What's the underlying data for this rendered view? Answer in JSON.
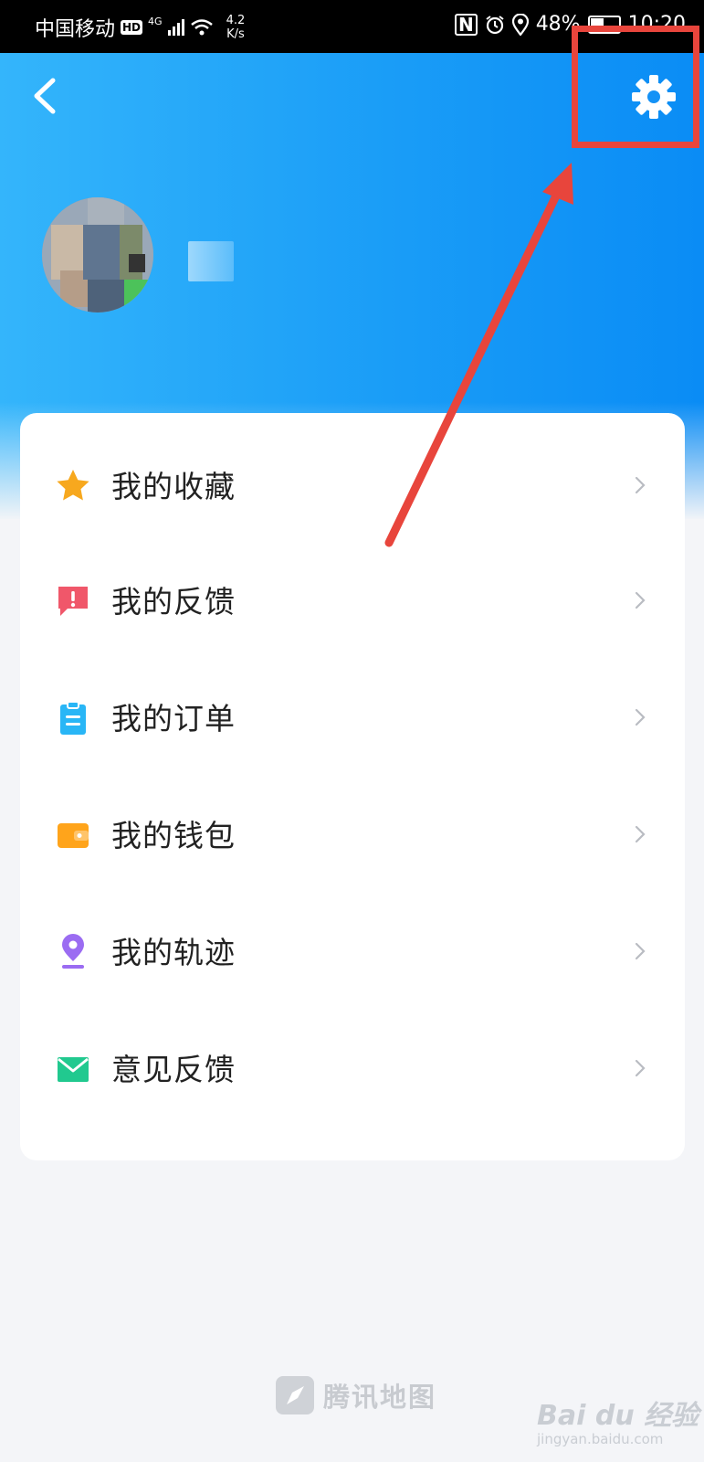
{
  "status_bar": {
    "carrier": "中国移动",
    "hd": "HD",
    "network": "4G",
    "speed_value": "4.2",
    "speed_unit": "K/s",
    "nfc": "N",
    "battery": "48%",
    "time": "10:20"
  },
  "menu": {
    "items": [
      {
        "label": "我的收藏",
        "icon": "star-icon",
        "color": "#f7a81e"
      },
      {
        "label": "我的反馈",
        "icon": "feedback-alert-icon",
        "color": "#f0576a"
      },
      {
        "label": "我的订单",
        "icon": "clipboard-icon",
        "color": "#29b6f6"
      },
      {
        "label": "我的钱包",
        "icon": "wallet-icon",
        "color": "#ffa41b"
      },
      {
        "label": "我的轨迹",
        "icon": "location-pin-icon",
        "color": "#9b6cf2"
      },
      {
        "label": "意见反馈",
        "icon": "envelope-icon",
        "color": "#21c98f"
      }
    ]
  },
  "footer": {
    "app_name": "腾讯地图",
    "watermark_main": "Bai du 经验",
    "watermark_sub": "jingyan.baidu.com"
  },
  "colors": {
    "header_start": "#34b5fb",
    "header_end": "#0a8cf5",
    "highlight": "#e8453c",
    "background": "#f4f5f8"
  }
}
